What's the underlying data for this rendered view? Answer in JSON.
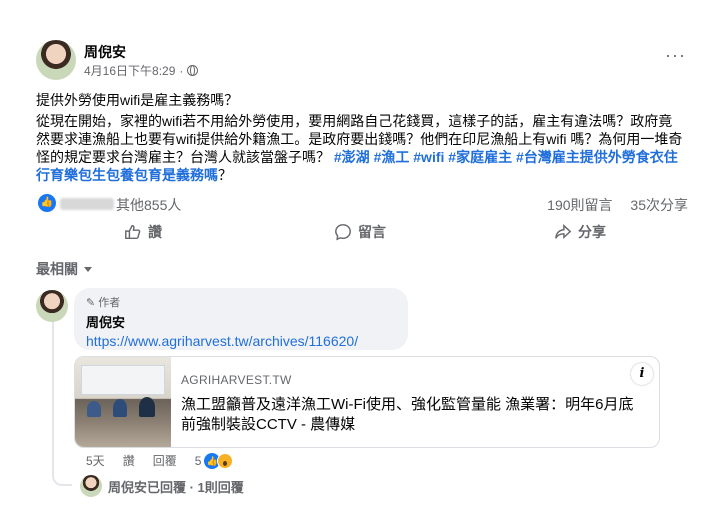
{
  "post": {
    "author": "周倪安",
    "timestamp": "4月16日下午8:29",
    "separator": "·",
    "more_label": "···",
    "title": "提供外勞使用wifi是雇主義務嗎？",
    "body_text": "從現在開始，家裡的wifi若不用給外勞使用，要用網路自己花錢買，這樣子的話，雇主有違法嗎？政府竟然要求連漁船上也要有wifi提供給外籍漁工。是政府要出錢嗎？他們在印尼漁船上有wifi 嗎？為何用一堆奇怪的規定要求台灣雇主？台灣人就該當盤子嗎？ ",
    "hashtags": [
      "#澎湖",
      "#漁工",
      "#wifi",
      "#家庭雇主",
      "#台灣雇主提供外勞食衣住行育樂包生包養包育是義務嗎"
    ],
    "body_end": "？"
  },
  "reactions": {
    "like_icon": "thumbs-up-icon",
    "others_text": "其他855人",
    "comments_count": "190則留言",
    "shares_count": "35次分享"
  },
  "actions": {
    "like_label": "讚",
    "comment_label": "留言",
    "share_label": "分享"
  },
  "sort": {
    "label": "最相關"
  },
  "comment": {
    "author_tag": "作者",
    "author": "周倪安",
    "link": "https://www.agriharvest.tw/archives/116620/",
    "preview": {
      "domain": "AGRIHARVEST.TW",
      "title": "漁工盟籲普及遠洋漁工Wi-Fi使用、強化監管量能 漁業署：明年6月底前強制裝設CCTV - 農傳媒",
      "info_label": "i"
    },
    "time": "5天",
    "like_label": "讚",
    "reply_label": "回覆",
    "reaction_count": "5"
  },
  "reply_summary": "周倪安已回覆 · 1則回覆",
  "colors": {
    "link": "#216fdb",
    "like_blue": "#1877f2",
    "muted": "#65676b"
  }
}
